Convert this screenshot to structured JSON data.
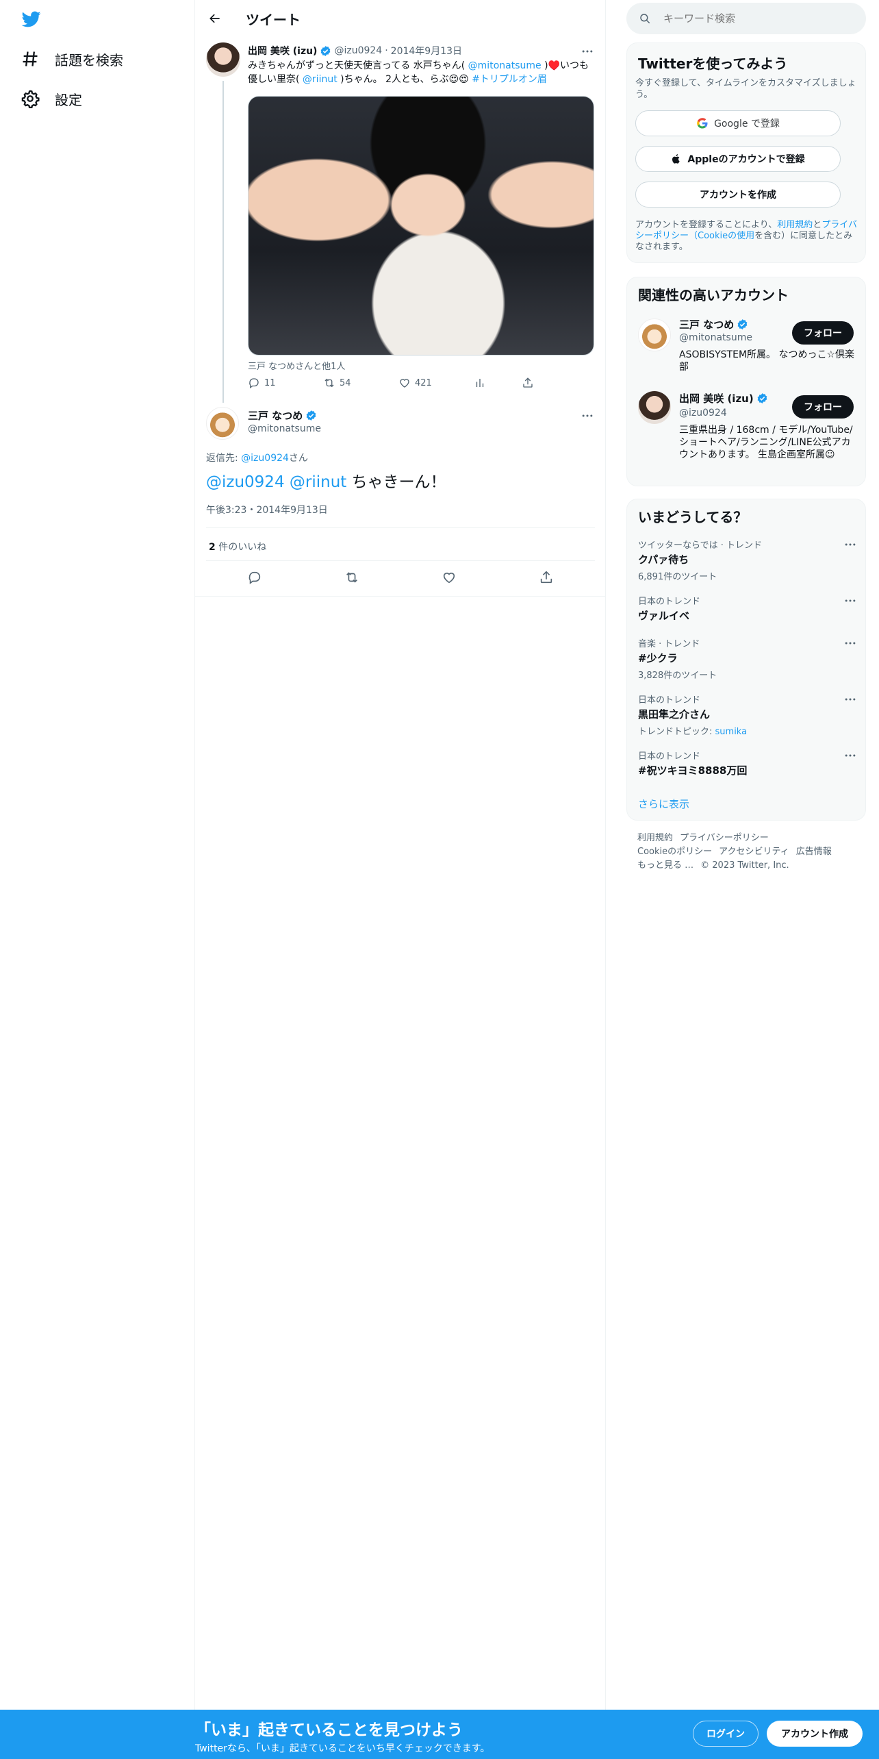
{
  "nav": {
    "logo": "twitter-bird-icon",
    "items": [
      {
        "label": "話題を検索",
        "icon": "hashtag-icon"
      },
      {
        "label": "設定",
        "icon": "gear-icon"
      }
    ]
  },
  "header": {
    "title": "ツイート"
  },
  "tweet1": {
    "name": "出岡 美咲 (izu)",
    "handle": "@izu0924",
    "date": "2014年9月13日",
    "text_pre": "みきちゃんがずっと天使天使言ってる 水戸ちゃん( ",
    "mention1": "@mitonatsume",
    "text_mid": " )♥️いつも優しい里奈( ",
    "mention2": "@riinut",
    "text_post": " )ちゃん。 2人とも、らぶ😍😍 ",
    "hashtag": "#トリプルオン眉",
    "photo_caption": "三戸 なつめさんと他1人",
    "replies": "11",
    "retweets": "54",
    "likes": "421"
  },
  "tweet2": {
    "name": "三戸 なつめ",
    "handle": "@mitonatsume",
    "replying_prefix": "返信先: ",
    "replying_to": "@izu0924",
    "replying_suffix": "さん",
    "mention1": "@izu0924",
    "mention2": "@riinut",
    "text": " ちゃきーん！",
    "timestamp": "午後3:23・2014年9月13日",
    "likes_count": "2",
    "likes_label": " 件のいいね"
  },
  "search": {
    "placeholder": "キーワード検索"
  },
  "signup": {
    "title": "Twitterを使ってみよう",
    "subtitle": "今すぐ登録して、タイムラインをカスタマイズしましょう。",
    "google_btn": "Google で登録",
    "apple_btn": "Appleのアカウントで登録",
    "create_btn": "アカウントを作成",
    "terms_pre": "アカウントを登録することにより、",
    "terms_link1": "利用規約",
    "terms_and": "と",
    "terms_link2": "プライバシーポリシー（Cookieの使用",
    "terms_post": "を含む）に同意したとみなされます。"
  },
  "related": {
    "title": "関連性の高いアカウント",
    "accounts": [
      {
        "name": "三戸 なつめ",
        "handle": "@mitonatsume",
        "bio": "ASOBISYSTEM所属。 なつめっこ☆倶楽部",
        "follow": "フォロー"
      },
      {
        "name": "出岡 美咲 (izu)",
        "handle": "@izu0924",
        "bio": "三重県出身 / 168cm / モデル/YouTube/ショートヘア/ランニング/LINE公式アカウントあります。 生島企画室所属☺︎",
        "follow": "フォロー"
      }
    ]
  },
  "trends": {
    "title": "いまどうしてる？",
    "items": [
      {
        "meta": "ツイッターならでは · トレンド",
        "name": "クパァ待ち",
        "extra": "6,891件のツイート"
      },
      {
        "meta": "日本のトレンド",
        "name": "ヴァルイベ",
        "extra": ""
      },
      {
        "meta": "音楽 · トレンド",
        "name": "#少クラ",
        "extra": "3,828件のツイート"
      },
      {
        "meta": "日本のトレンド",
        "name": "黒田隼之介さん",
        "extra_prefix": "トレンドトピック: ",
        "extra_link": "sumika"
      },
      {
        "meta": "日本のトレンド",
        "name": "#祝ツキヨミ8888万回",
        "extra": ""
      }
    ],
    "show_more": "さらに表示"
  },
  "footer": {
    "links": [
      "利用規約",
      "プライバシーポリシー",
      "Cookieのポリシー",
      "アクセシビリティ",
      "広告情報",
      "もっと見る …"
    ],
    "copyright": "© 2023 Twitter, Inc."
  },
  "bottombar": {
    "title": "「いま」起きていることを見つけよう",
    "subtitle": "Twitterなら、「いま」起きていることをいち早くチェックできます。",
    "login": "ログイン",
    "signup": "アカウント作成"
  },
  "colors": {
    "accent": "#1d9bf0",
    "text": "#0f1419",
    "muted": "#536471"
  }
}
